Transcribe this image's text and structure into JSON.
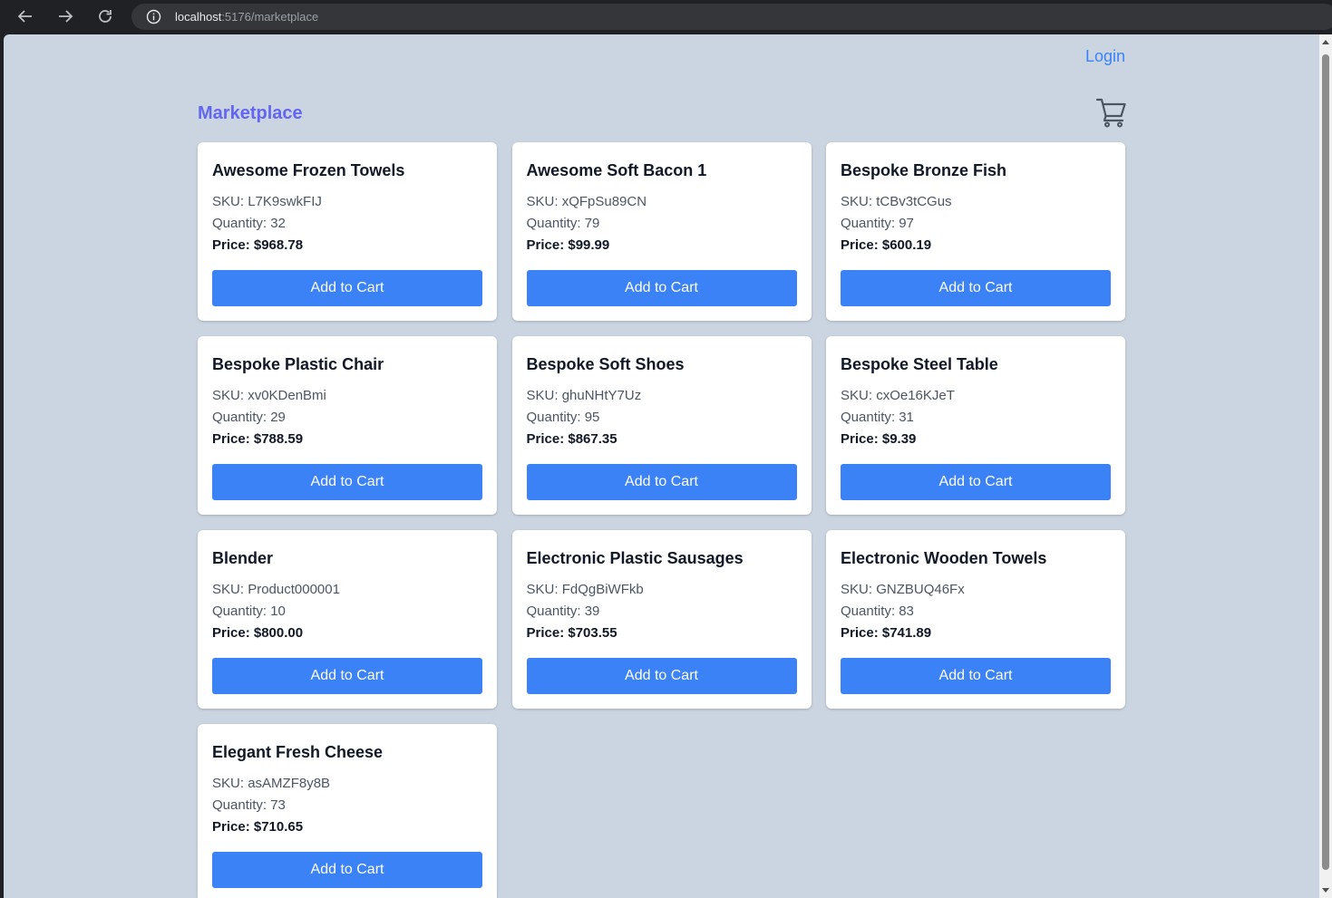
{
  "browser": {
    "url_host": "localhost",
    "url_path": ":5176/marketplace"
  },
  "header": {
    "login_label": "Login",
    "title": "Marketplace"
  },
  "labels": {
    "sku_prefix": "SKU: ",
    "quantity_prefix": "Quantity: ",
    "price_prefix": "Price: ",
    "add_to_cart": "Add to Cart"
  },
  "colors": {
    "page_background": "#cbd5e1",
    "accent_button": "#3b82f6",
    "title": "#6366f1",
    "login_link": "#3b82f6"
  },
  "products": [
    {
      "name": "Awesome Frozen Towels",
      "sku": "L7K9swkFIJ",
      "quantity": "32",
      "price": "$968.78"
    },
    {
      "name": "Awesome Soft Bacon 1",
      "sku": "xQFpSu89CN",
      "quantity": "79",
      "price": "$99.99"
    },
    {
      "name": "Bespoke Bronze Fish",
      "sku": "tCBv3tCGus",
      "quantity": "97",
      "price": "$600.19"
    },
    {
      "name": "Bespoke Plastic Chair",
      "sku": "xv0KDenBmi",
      "quantity": "29",
      "price": "$788.59"
    },
    {
      "name": "Bespoke Soft Shoes",
      "sku": "ghuNHtY7Uz",
      "quantity": "95",
      "price": "$867.35"
    },
    {
      "name": "Bespoke Steel Table",
      "sku": "cxOe16KJeT",
      "quantity": "31",
      "price": "$9.39"
    },
    {
      "name": "Blender",
      "sku": "Product000001",
      "quantity": "10",
      "price": "$800.00"
    },
    {
      "name": "Electronic Plastic Sausages",
      "sku": "FdQgBiWFkb",
      "quantity": "39",
      "price": "$703.55"
    },
    {
      "name": "Electronic Wooden Towels",
      "sku": "GNZBUQ46Fx",
      "quantity": "83",
      "price": "$741.89"
    },
    {
      "name": "Elegant Fresh Cheese",
      "sku": "asAMZF8y8B",
      "quantity": "73",
      "price": "$710.65"
    }
  ]
}
